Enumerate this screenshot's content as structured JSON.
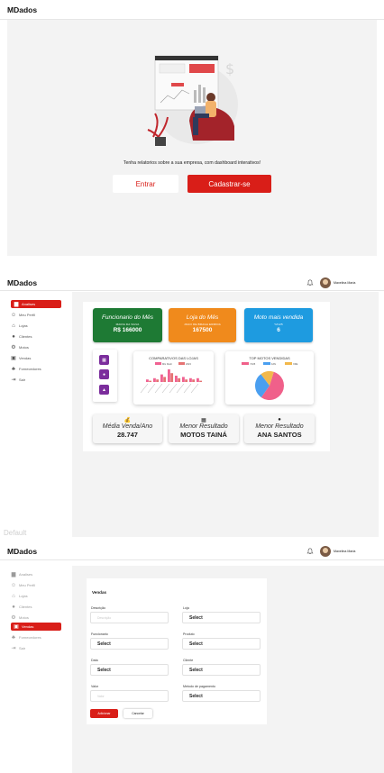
{
  "brand": "MDados",
  "user": {
    "name": "Maxelina Maria"
  },
  "landing": {
    "tagline": "Tenha relatorios sobre a sua empresa, com dashboard interativos!",
    "login_label": "Entrar",
    "signup_label": "Cadastrar-se"
  },
  "sidebar": {
    "items": [
      {
        "label": "Analises",
        "icon": "chart-icon"
      },
      {
        "label": "Meu Perfil",
        "icon": "user-icon"
      },
      {
        "label": "Lojas",
        "icon": "store-icon"
      },
      {
        "label": "Clientes",
        "icon": "person-icon"
      },
      {
        "label": "Motos",
        "icon": "motorcycle-icon"
      },
      {
        "label": "Vendas",
        "icon": "cart-icon"
      },
      {
        "label": "Fornecedores",
        "icon": "group-icon"
      },
      {
        "label": "Sair",
        "icon": "logout-icon"
      }
    ]
  },
  "dashboard": {
    "kpis": [
      {
        "title": "Funcionario do Mês",
        "sub": "MARIA DA SILVA",
        "value": "R$ 166000",
        "color": "#1e7a34"
      },
      {
        "title": "Loja do Mês",
        "sub": "JOAO DE BRAGA ERMIDA",
        "value": "167500",
        "color": "#f08a1c"
      },
      {
        "title": "Moto mais vendida",
        "sub": "YZ125",
        "value": "6",
        "color": "#1e9be0"
      }
    ],
    "bar_panel_title": "COMPARATIVOS DAS LOJAS",
    "pie_panel_title": "TOP MOTOS VENDIDAS",
    "bottom_cards": [
      {
        "title": "Média Venda/Ano",
        "value": "28.747",
        "icon": "money-bag-icon"
      },
      {
        "title": "Menor Resultado",
        "value": "MOTOS TAINÁ",
        "icon": "calendar-icon"
      },
      {
        "title": "Menor Resultado",
        "value": "ANA SANTOS",
        "icon": "person-icon"
      }
    ]
  },
  "chart_data": [
    {
      "type": "bar",
      "title": "COMPARATIVOS DAS LOJAS",
      "series": [
        {
          "name": "MG Rush",
          "values": [
            2,
            3,
            6,
            10,
            5,
            4,
            3,
            3
          ],
          "color": "#f06292"
        },
        {
          "name": "2023",
          "values": [
            1,
            2,
            4,
            7,
            3,
            2,
            2,
            1
          ],
          "color": "#e57373"
        }
      ]
    },
    {
      "type": "pie",
      "title": "TOP MOTOS VENDIDAS",
      "categories": [
        "YZ25",
        "FAN",
        "XRE"
      ],
      "values": [
        55,
        30,
        15
      ],
      "colors": [
        "#f0608a",
        "#4a9ff0",
        "#f2b84b"
      ]
    }
  ],
  "default_label": "Default",
  "form": {
    "title": "Vendas",
    "fields": [
      {
        "label": "Descrição",
        "value": "",
        "placeholder": "Descrição"
      },
      {
        "label": "Loja",
        "value": "Select"
      },
      {
        "label": "Funcionario",
        "value": "Select"
      },
      {
        "label": "Produto",
        "value": "Select"
      },
      {
        "label": "Data",
        "value": "Select"
      },
      {
        "label": "Cliente",
        "value": "Select"
      },
      {
        "label": "Valor",
        "value": "",
        "placeholder": "Valor"
      },
      {
        "label": "Metodo de pagamento",
        "value": "Select"
      }
    ],
    "add_label": "Adicionar",
    "cancel_label": "Cancelar"
  }
}
